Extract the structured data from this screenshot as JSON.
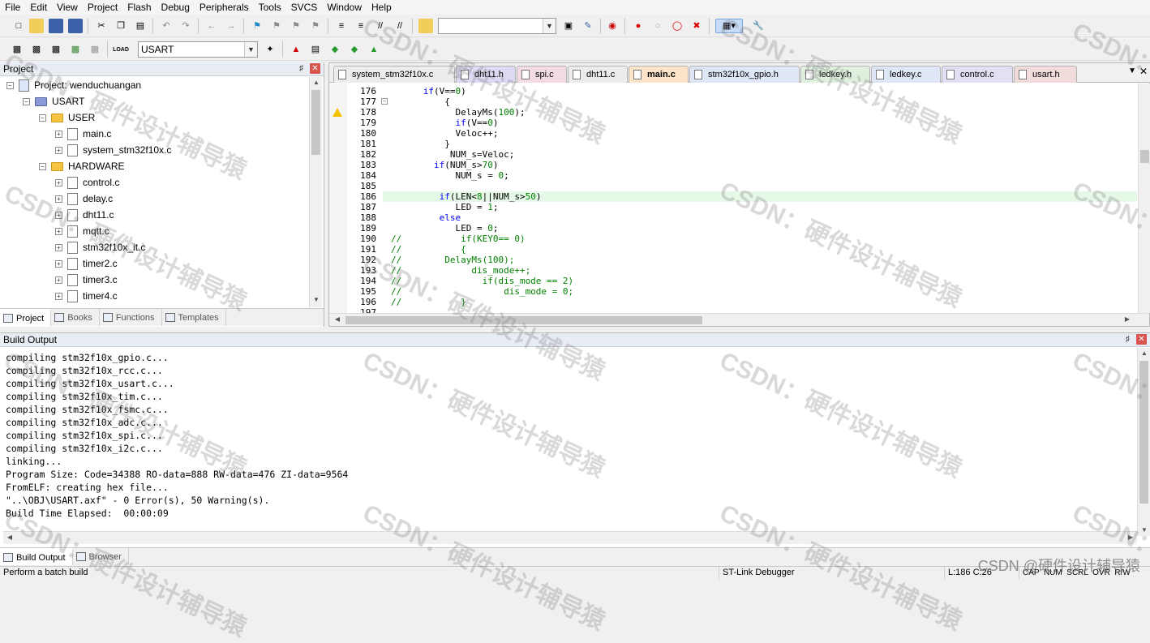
{
  "menu": [
    "File",
    "Edit",
    "View",
    "Project",
    "Flash",
    "Debug",
    "Peripherals",
    "Tools",
    "SVCS",
    "Window",
    "Help"
  ],
  "toolbar": {
    "target_select": "USART"
  },
  "project_panel": {
    "title": "Project",
    "tree": [
      {
        "label": "Project: wenduchuangan",
        "type": "project",
        "level": 0
      },
      {
        "label": "USART",
        "type": "target",
        "level": 1
      },
      {
        "label": "USER",
        "type": "folder",
        "level": 2
      },
      {
        "label": "main.c",
        "type": "file",
        "level": 3
      },
      {
        "label": "system_stm32f10x.c",
        "type": "file",
        "level": 3
      },
      {
        "label": "HARDWARE",
        "type": "folder",
        "level": 2
      },
      {
        "label": "control.c",
        "type": "file",
        "level": 3
      },
      {
        "label": "delay.c",
        "type": "file",
        "level": 3
      },
      {
        "label": "dht11.c",
        "type": "file",
        "level": 3
      },
      {
        "label": "mqtt.c",
        "type": "file",
        "level": 3
      },
      {
        "label": "stm32f10x_it.c",
        "type": "file",
        "level": 3
      },
      {
        "label": "timer2.c",
        "type": "file",
        "level": 3
      },
      {
        "label": "timer3.c",
        "type": "file",
        "level": 3
      },
      {
        "label": "timer4.c",
        "type": "file",
        "level": 3
      }
    ],
    "tabs": [
      "Project",
      "Books",
      "Functions",
      "Templates"
    ]
  },
  "editor": {
    "tabs": [
      {
        "label": "system_stm32f10x.c",
        "color": "#ececec"
      },
      {
        "label": "dht11.h",
        "color": "#dcd9f2"
      },
      {
        "label": "spi.c",
        "color": "#f2dbe5"
      },
      {
        "label": "dht11.c",
        "color": "#ececec"
      },
      {
        "label": "main.c",
        "color": "#fbe4c8",
        "active": true
      },
      {
        "label": "stm32f10x_gpio.h",
        "color": "#dfe6f5"
      },
      {
        "label": "ledkey.h",
        "color": "#dff0df"
      },
      {
        "label": "ledkey.c",
        "color": "#dfe6f5"
      },
      {
        "label": "control.c",
        "color": "#e4dff2"
      },
      {
        "label": "usart.h",
        "color": "#f2dbdb"
      }
    ],
    "lines": [
      {
        "n": "176",
        "code": "      if(V==0)"
      },
      {
        "n": "177",
        "code": "          {"
      },
      {
        "n": "178",
        "code": "            DelayMs(100);"
      },
      {
        "n": "179",
        "code": "            if(V==0)"
      },
      {
        "n": "180",
        "code": "            Veloc++;"
      },
      {
        "n": "181",
        "code": "          }"
      },
      {
        "n": "182",
        "code": "           NUM_s=Veloc;"
      },
      {
        "n": "183",
        "code": "        if(NUM_s>70)"
      },
      {
        "n": "184",
        "code": "            NUM_s = 0;"
      },
      {
        "n": "185",
        "code": ""
      },
      {
        "n": "186",
        "code": "         if(LEN<8||NUM_s>50)"
      },
      {
        "n": "187",
        "code": "            LED = 1;"
      },
      {
        "n": "188",
        "code": "         else"
      },
      {
        "n": "189",
        "code": "            LED = 0;"
      },
      {
        "n": "190",
        "code": "//           if(KEY0== 0)"
      },
      {
        "n": "191",
        "code": "//           {"
      },
      {
        "n": "192",
        "code": "//        DelayMs(100);"
      },
      {
        "n": "193",
        "code": "//             dis_mode++;"
      },
      {
        "n": "194",
        "code": "//               if(dis_mode == 2)"
      },
      {
        "n": "195",
        "code": "//                   dis_mode = 0;"
      },
      {
        "n": "196",
        "code": "//           }"
      },
      {
        "n": "197",
        "code": ""
      }
    ]
  },
  "build_output": {
    "title": "Build Output",
    "lines": [
      "compiling stm32f10x_gpio.c...",
      "compiling stm32f10x_rcc.c...",
      "compiling stm32f10x_usart.c...",
      "compiling stm32f10x_tim.c...",
      "compiling stm32f10x_fsmc.c...",
      "compiling stm32f10x_adc.c...",
      "compiling stm32f10x_spi.c...",
      "compiling stm32f10x_i2c.c...",
      "linking...",
      "Program Size: Code=34388 RO-data=888 RW-data=476 ZI-data=9564",
      "FromELF: creating hex file...",
      "\"..\\OBJ\\USART.axf\" - 0 Error(s), 50 Warning(s).",
      "Build Time Elapsed:  00:00:09"
    ],
    "tabs": [
      "Build Output",
      "Browser"
    ]
  },
  "status": {
    "message": "Perform a batch build",
    "debugger": "ST-Link Debugger",
    "position": "L:186 C:26",
    "indicators": "CAP  NUM  SCRL  OVR  R/W"
  },
  "watermark": {
    "text": "CSDN：硬件设计辅导猿",
    "corner": "CSDN @硬件设计辅导猿"
  }
}
